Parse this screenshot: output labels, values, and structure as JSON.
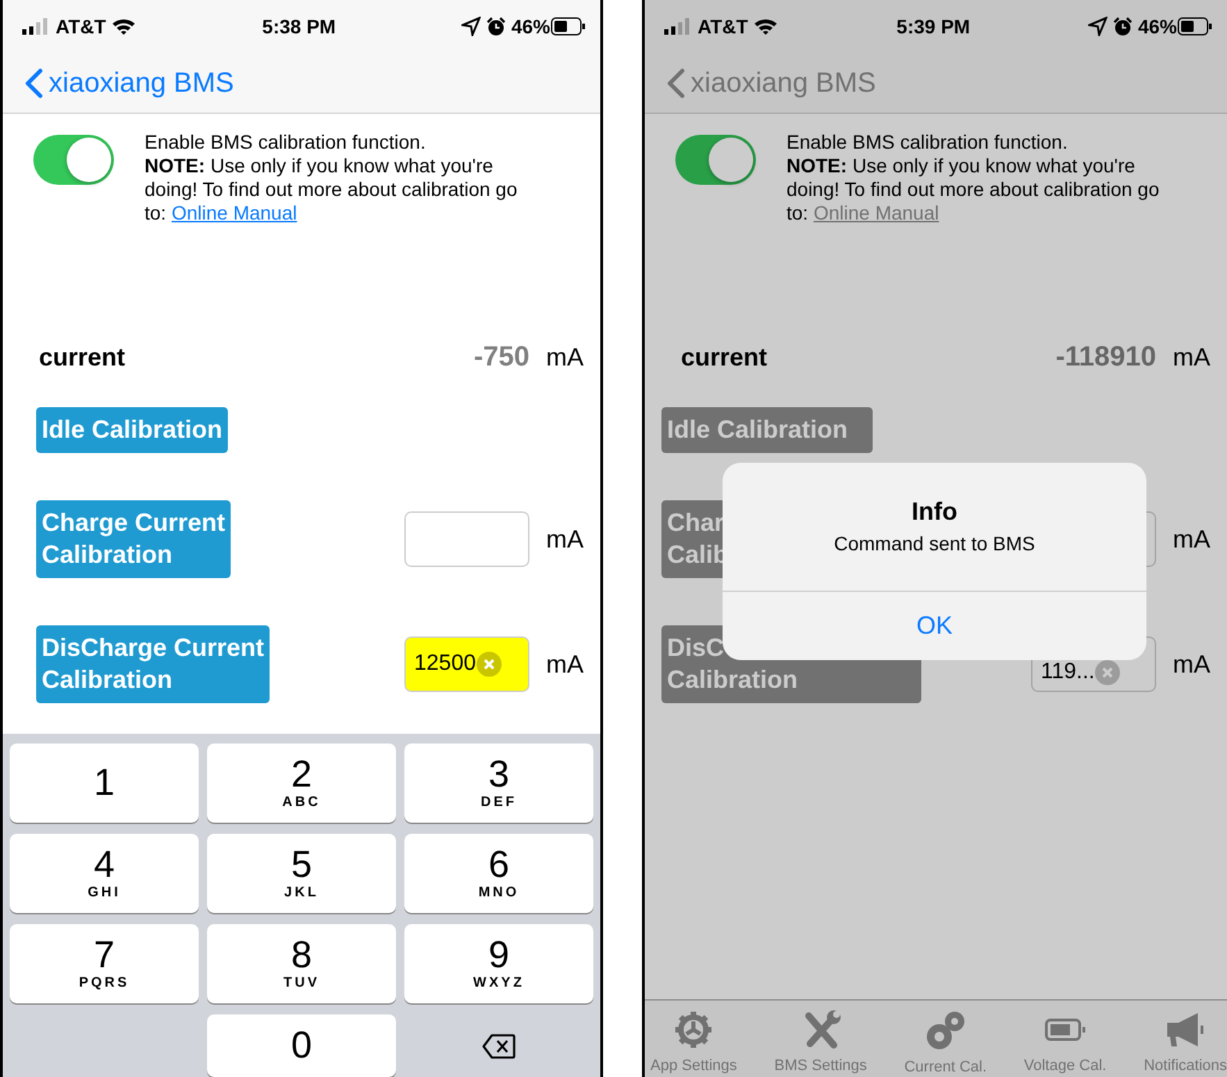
{
  "screens": [
    {
      "status_bar": {
        "carrier": "AT&T",
        "time": "5:38 PM",
        "battery": "46%"
      },
      "nav": {
        "back_label": "xiaoxiang BMS"
      },
      "dimmed": false,
      "calibration": {
        "on": true,
        "title": "Enable BMS calibration function.",
        "note": "**NOTE:** Use only if you know what you're doing! To find out more about calibration go to:",
        "link": "Online Manual"
      },
      "current": {
        "label": "current",
        "value": "-750",
        "unit": "mA"
      },
      "actions": [
        {
          "lines": [
            "Idle Calibration"
          ]
        },
        {
          "lines": [
            "Charge Current",
            "Calibration"
          ],
          "field": {
            "highlighted": false,
            "clear_button": false,
            "unit": "mA"
          }
        },
        {
          "lines": [
            "DisCharge Current",
            "Calibration"
          ],
          "field": {
            "value": "12500",
            "highlighted": true,
            "clear_button": true,
            "unit": "mA"
          }
        }
      ],
      "keypad": [
        {
          "kind": "key",
          "digit": "1"
        },
        {
          "kind": "key",
          "digit": "2",
          "letters": "ABC"
        },
        {
          "kind": "key",
          "digit": "3",
          "letters": "DEF"
        },
        {
          "kind": "key",
          "digit": "4",
          "letters": "GHI"
        },
        {
          "kind": "key",
          "digit": "5",
          "letters": "JKL"
        },
        {
          "kind": "key",
          "digit": "6",
          "letters": "MNO"
        },
        {
          "kind": "key",
          "digit": "7",
          "letters": "PQRS"
        },
        {
          "kind": "key",
          "digit": "8",
          "letters": "TUV"
        },
        {
          "kind": "key",
          "digit": "9",
          "letters": "WXYZ"
        },
        {
          "kind": "blank"
        },
        {
          "kind": "key",
          "digit": "0"
        },
        {
          "kind": "backspace"
        }
      ]
    },
    {
      "status_bar": {
        "carrier": "AT&T",
        "time": "5:39 PM",
        "battery": "46%"
      },
      "nav": {
        "back_label": "xiaoxiang BMS"
      },
      "dimmed": true,
      "calibration": {
        "on": true,
        "title": "Enable BMS calibration function.",
        "note": "**NOTE:** Use only if you know what you're doing! To find out more about calibration go to:",
        "link": "Online Manual"
      },
      "current": {
        "label": "current",
        "value": "-118910",
        "unit": "mA"
      },
      "actions": [
        {
          "lines": [
            "Idle Calibration"
          ]
        },
        {
          "lines": [
            "Char",
            "Calib"
          ],
          "field": {
            "unit": "mA"
          }
        },
        {
          "lines": [
            "DisC",
            "Calibration"
          ],
          "field": {
            "value": "119...",
            "highlighted": false,
            "clear_button": true,
            "unit": "mA"
          }
        }
      ],
      "alert": {
        "title": "Info",
        "message": "Command sent to BMS",
        "button": "OK"
      },
      "tab_bar": [
        {
          "label": "App Settings"
        },
        {
          "label": "BMS Settings"
        },
        {
          "label": "Current Cal."
        },
        {
          "label": "Voltage Cal."
        },
        {
          "label": "Notifications"
        }
      ]
    }
  ]
}
